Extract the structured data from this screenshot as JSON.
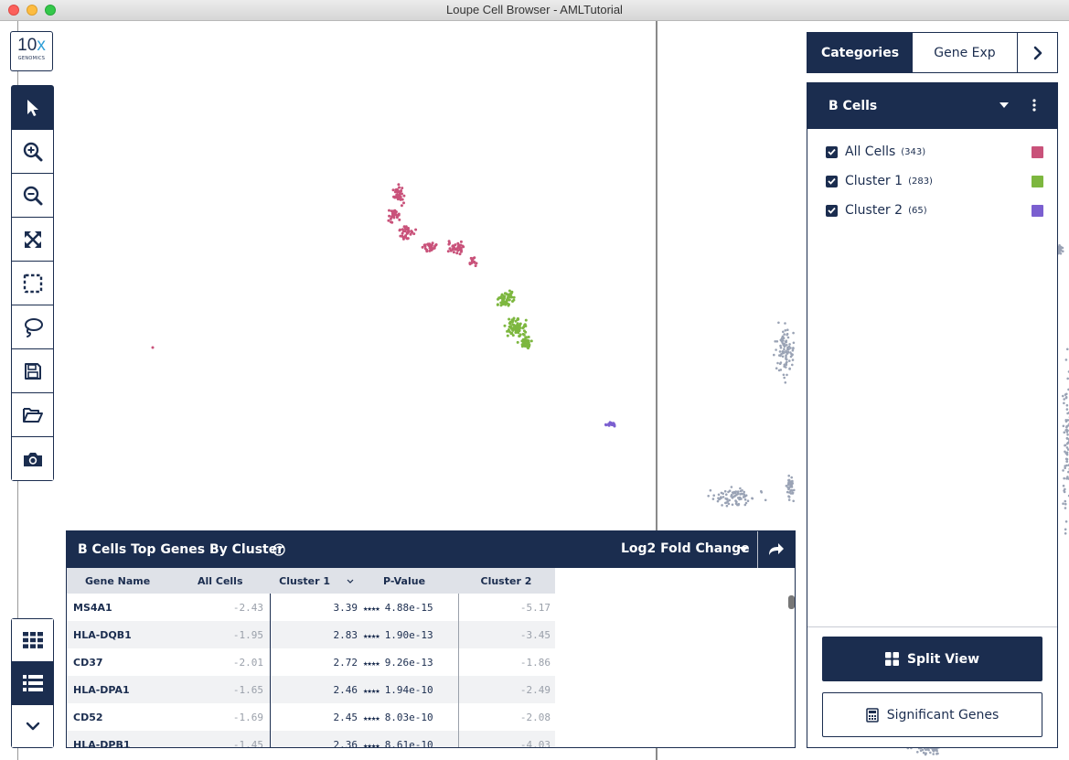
{
  "window": {
    "title": "Loupe Cell Browser - AMLTutorial"
  },
  "logo": {
    "text_main": "10",
    "text_x": "x",
    "text_sub": "GENOMICS"
  },
  "tabs": {
    "categories": "Categories",
    "gene_exp": "Gene Exp"
  },
  "category_panel": {
    "title": "B Cells",
    "items": [
      {
        "label": "All Cells",
        "count": "(343)",
        "color": "#c9527a",
        "checked": true
      },
      {
        "label": "Cluster 1",
        "count": "(283)",
        "color": "#7db73f",
        "checked": true
      },
      {
        "label": "Cluster 2",
        "count": "(65)",
        "color": "#7b5fd0",
        "checked": true
      }
    ],
    "split_view_label": "Split View",
    "significant_genes_label": "Significant Genes"
  },
  "genes_panel": {
    "title": "B Cells Top Genes By Cluster",
    "metric": "Log2 Fold Change",
    "columns": [
      "Gene Name",
      "All Cells",
      "Cluster 1",
      "P-Value",
      "Cluster 2"
    ],
    "stars": "★★★★",
    "rows": [
      {
        "gene": "MS4A1",
        "all": "-2.43",
        "c1": "3.39",
        "pvalue": "4.88e-15",
        "c2": "-5.17"
      },
      {
        "gene": "HLA-DQB1",
        "all": "-1.95",
        "c1": "2.83",
        "pvalue": "1.90e-13",
        "c2": "-3.45"
      },
      {
        "gene": "CD37",
        "all": "-2.01",
        "c1": "2.72",
        "pvalue": "9.26e-13",
        "c2": "-1.86"
      },
      {
        "gene": "HLA-DPA1",
        "all": "-1.65",
        "c1": "2.46",
        "pvalue": "1.94e-10",
        "c2": "-2.49"
      },
      {
        "gene": "CD52",
        "all": "-1.69",
        "c1": "2.45",
        "pvalue": "8.03e-10",
        "c2": "-2.08"
      },
      {
        "gene": "HLA-DPB1",
        "all": "-1.45",
        "c1": "2.36",
        "pvalue": "8.61e-10",
        "c2": "-4.03"
      }
    ]
  },
  "colors": {
    "navy": "#1b2d4f",
    "all_cells": "#c9527a",
    "cluster1": "#7db73f",
    "cluster2": "#7b5fd0",
    "background_cells": "#9aa3b5"
  },
  "toolbar_icons": [
    "pointer-icon",
    "zoom-in-icon",
    "zoom-out-icon",
    "fit-screen-icon",
    "box-select-icon",
    "lasso-icon",
    "save-icon",
    "open-folder-icon",
    "camera-icon"
  ],
  "view_icons": [
    "grid-view-icon",
    "list-view-icon",
    "chevron-down-icon"
  ]
}
